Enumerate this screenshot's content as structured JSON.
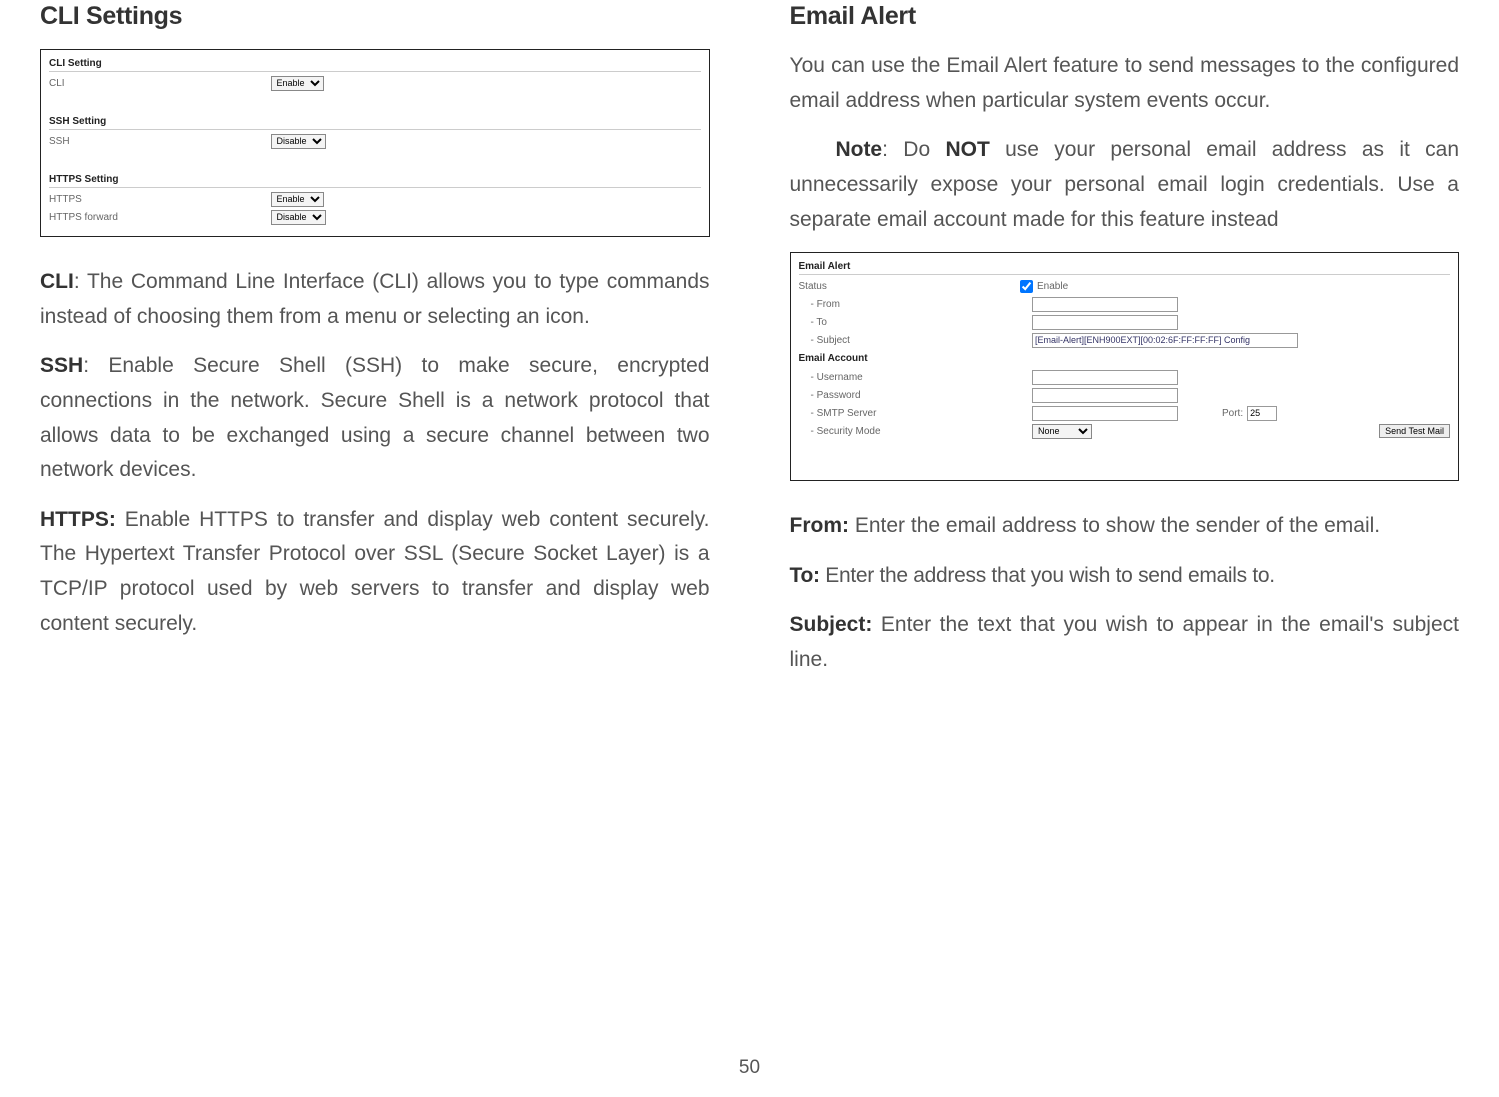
{
  "left": {
    "heading": "CLI Settings",
    "screenshot_cli": {
      "sec1_title": "CLI Setting",
      "row1_label": "CLI",
      "row1_value": "Enable",
      "sec2_title": "SSH Setting",
      "row2_label": "SSH",
      "row2_value": "Disable",
      "sec3_title": "HTTPS Setting",
      "row3_label": "HTTPS",
      "row3_value": "Enable",
      "row4_label": "HTTPS forward",
      "row4_value": "Disable"
    },
    "p1_b": "CLI",
    "p1": ": The Command Line Interface (CLI) allows you to type commands instead of choosing them from a menu or selecting an icon.",
    "p2_b": "SSH",
    "p2": ": Enable Secure Shell (SSH) to make secure, encrypted connections in the network. Secure Shell is a network protocol that allows data to be exchanged using a secure channel between two network devices.",
    "p3_b": "HTTPS:",
    "p3": " Enable HTTPS to transfer and display web content securely. The Hypertext Transfer Protocol over SSL (Secure Socket Layer) is a TCP/IP protocol used by web servers to transfer and display web content securely."
  },
  "right": {
    "heading": "Email Alert",
    "intro": "You can use the Email Alert feature to send messages to the configured email address when particular system events occur.",
    "note_label": "   Note",
    "note_mid": ": Do ",
    "note_not": "NOT",
    "note_rest": " use your personal email address as it can unnecessarily expose your personal email login credentials. Use a separate email account made for this feature instead",
    "screenshot_email": {
      "sec1_title": "Email Alert",
      "status_label": "Status",
      "status_cb": "Enable",
      "from_label": "- From",
      "to_label": "- To",
      "subject_label": "- Subject",
      "subject_value": "[Email-Alert][ENH900EXT][00:02:6F:FF:FF:FF] Config",
      "sec2_title": "Email Account",
      "username_label": "- Username",
      "password_label": "- Password",
      "smtp_label": "- SMTP Server",
      "port_label": "Port:",
      "port_value": "25",
      "sec_mode_label": "- Security Mode",
      "sec_mode_value": "None",
      "send_btn": "Send Test Mail"
    },
    "from_b": "From:",
    "from_t": " Enter the email address to show the sender of the email.",
    "to_b": "To:",
    "to_t": " Enter the address that you wish to send emails to.",
    "subj_b": "Subject:",
    "subj_t": " Enter the text that you wish to appear in the email's subject line."
  },
  "page_number": "50"
}
